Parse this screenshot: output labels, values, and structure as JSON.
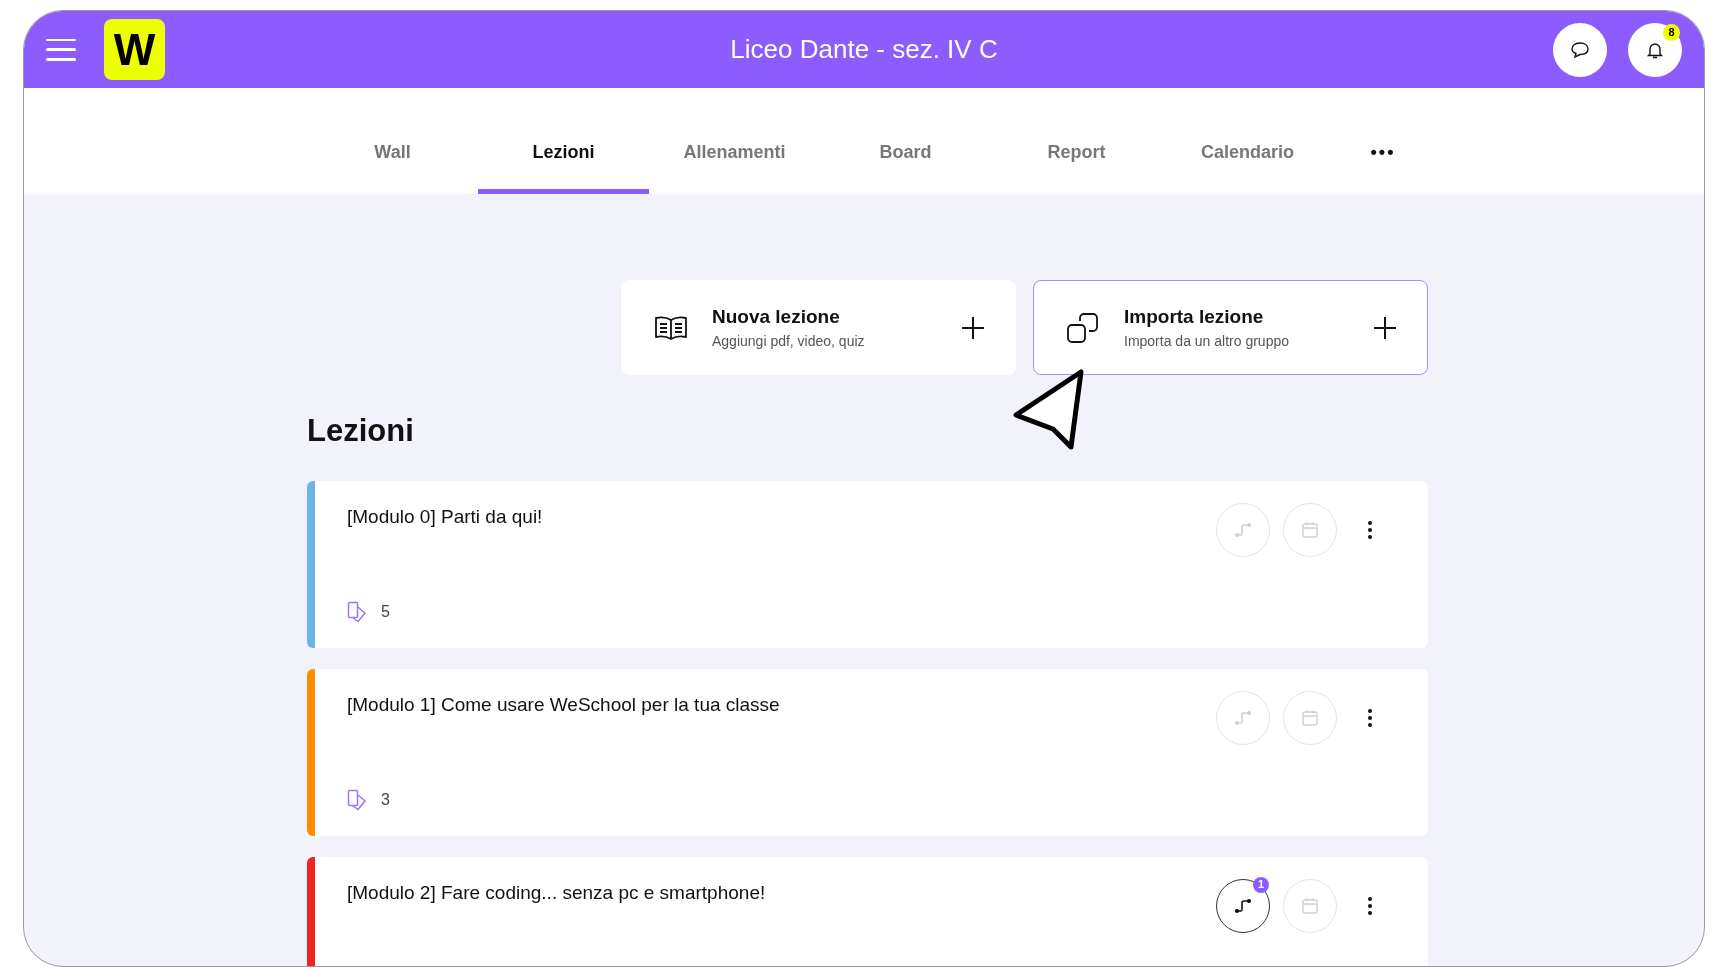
{
  "header": {
    "title": "Liceo Dante - sez. IV C",
    "logo": "W",
    "notifications": "8"
  },
  "tabs": [
    {
      "label": "Wall",
      "selected": false
    },
    {
      "label": "Lezioni",
      "selected": true
    },
    {
      "label": "Allenamenti",
      "selected": false
    },
    {
      "label": "Board",
      "selected": false
    },
    {
      "label": "Report",
      "selected": false
    },
    {
      "label": "Calendario",
      "selected": false
    }
  ],
  "more_tab": "•••",
  "actions": [
    {
      "kind": "new",
      "title": "Nuova lezione",
      "subtitle": "Aggiungi pdf, video, quiz",
      "selected": false
    },
    {
      "kind": "import",
      "title": "Importa lezione",
      "subtitle": "Importa da un altro gruppo",
      "selected": true
    }
  ],
  "section_title": "Lezioni",
  "lessons": [
    {
      "title": "[Modulo 0] Parti da qui!",
      "color": "#6cb4e8",
      "count": "5",
      "path_active": false
    },
    {
      "title": "[Modulo 1] Come usare WeSchool per la tua classe",
      "color": "#ff8a00",
      "count": "3",
      "path_active": false
    },
    {
      "title": "[Modulo 2] Fare coding... senza pc e smartphone!",
      "color": "#f0231e",
      "path_active": true,
      "path_badge": "1"
    }
  ]
}
